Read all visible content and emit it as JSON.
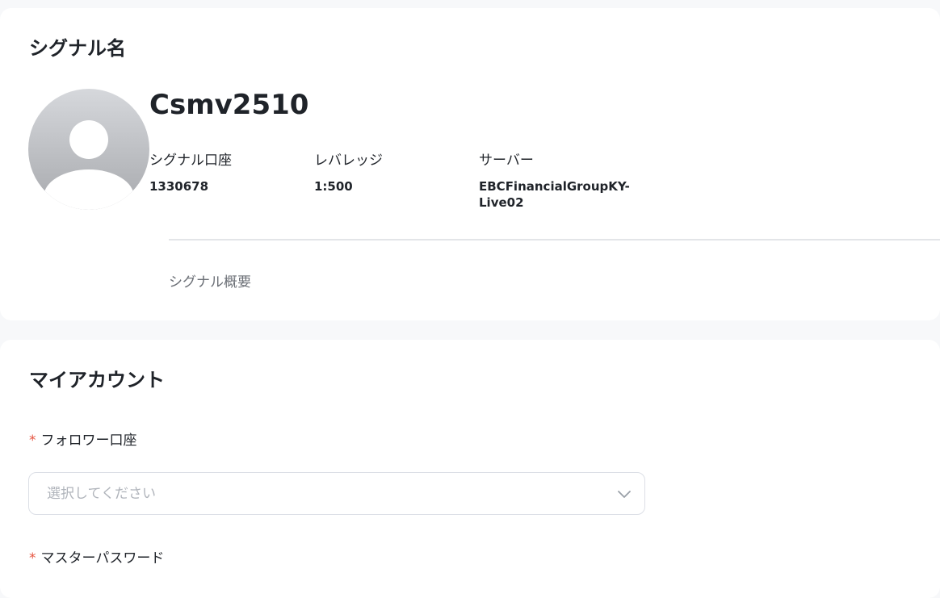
{
  "signal": {
    "section_title": "シグナル名",
    "name": "Csmv2510",
    "avatar_icon": "user-avatar-icon",
    "account_label": "シグナル口座",
    "account_value": "1330678",
    "leverage_label": "レバレッジ",
    "leverage_value": "1:500",
    "server_label": "サーバー",
    "server_value_line1": "EBCFinancialGroupKY-",
    "server_value_line2": "Live02",
    "summary_label": "シグナル概要"
  },
  "account": {
    "section_title": "マイアカウント",
    "required_mark": "*",
    "follower_label": "フォロワー口座",
    "follower_placeholder": "選択してください",
    "chevron_icon": "chevron-down-icon",
    "password_label": "マスターパスワード"
  },
  "colors": {
    "required": "#e5533f",
    "placeholder": "#b0b4bb",
    "border": "#dcdfe6"
  }
}
